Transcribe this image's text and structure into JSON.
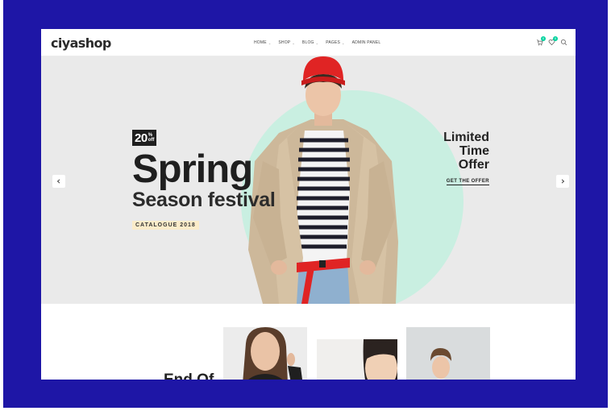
{
  "brand": {
    "logo": "ciyashop"
  },
  "nav": [
    {
      "label": "HOME"
    },
    {
      "label": "SHOP"
    },
    {
      "label": "BLOG"
    },
    {
      "label": "PAGES"
    },
    {
      "label": "ADMIN PANEL"
    }
  ],
  "header_icons": {
    "cart": {
      "icon": "cart-icon",
      "count": "0"
    },
    "wishlist": {
      "icon": "heart-icon",
      "count": "0"
    },
    "search": {
      "icon": "search-icon"
    }
  },
  "hero": {
    "discount_number": "20",
    "discount_percent": "%",
    "discount_off": "off",
    "headline": "Spring",
    "subheadline": "Season festival",
    "tag": "CATALOGUE 2018",
    "promo_line1": "Limited",
    "promo_line2": "Time",
    "promo_line3": "Offer",
    "cta_label": "GET THE OFFER"
  },
  "bottom": {
    "partial_title": "End Of"
  },
  "colors": {
    "frame": "#1e16a6",
    "accent": "#04d39f",
    "hero_bg": "#eaeaea",
    "circle": "#c9efe1",
    "hat": "#e02424"
  }
}
